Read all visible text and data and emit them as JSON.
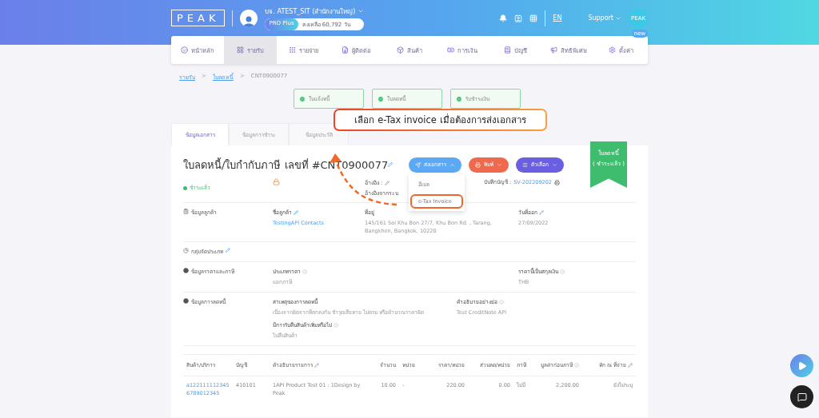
{
  "header": {
    "logo": "PEAK",
    "company": "บจ. ATEST_SIT (สำนักงานใหญ่)",
    "plan": "PRO Plus",
    "remaining": "คงเหลือ 60,792 วัน",
    "language": "EN",
    "support": "Support",
    "support_badge": "PEAK"
  },
  "nav": [
    {
      "label": "หน้าหลัก",
      "selected": false
    },
    {
      "label": "รายรับ",
      "selected": true
    },
    {
      "label": "รายจ่าย",
      "selected": false
    },
    {
      "label": "ผู้ติดต่อ",
      "selected": false
    },
    {
      "label": "สินค้า",
      "selected": false
    },
    {
      "label": "การเงิน",
      "selected": false
    },
    {
      "label": "บัญชี",
      "selected": false
    },
    {
      "label": "สิทธิพิเศษ",
      "selected": false
    },
    {
      "label": "ตั้งค่า",
      "selected": false,
      "badge": "new"
    }
  ],
  "breadcrumb": {
    "separator": ">",
    "items": [
      {
        "label": "รายรับ",
        "link": true
      },
      {
        "label": "ใบลดหนี้",
        "link": true
      },
      {
        "label": "CNT0900077",
        "link": false
      }
    ]
  },
  "steps": [
    {
      "label": "ใบแจ้งหนี้",
      "done": true
    },
    {
      "label": "ใบลดหนี้",
      "done": true
    },
    {
      "label": "รับชำระเงิน",
      "done": true
    }
  ],
  "callout": "เลือก e-Tax invoice เมื่อต้องการส่งเอกสาร",
  "tabs": [
    {
      "label": "ข้อมูลเอกสาร",
      "selected": true
    },
    {
      "label": "ข้อมูลการชำระ",
      "selected": false
    },
    {
      "label": "ข้อมูลประวัติ",
      "selected": false
    }
  ],
  "document": {
    "title": "ใบลดหนี้/ใบกำกับภาษี เลขที่ #CNT0900077",
    "actions": [
      {
        "label": "ส่งเอกสาร",
        "kind": "send",
        "expanded": true
      },
      {
        "label": "พิมพ์",
        "kind": "print",
        "expanded": false
      },
      {
        "label": "ตัวเลือก",
        "kind": "options",
        "expanded": false
      }
    ],
    "menu": [
      {
        "label": "อีเมล",
        "selected": false
      },
      {
        "label": "e-Tax Invoice",
        "selected": true
      }
    ],
    "ribbon": [
      "ใบลดหนี้",
      "( ชำระแล้ว )"
    ],
    "status": "ชำระแล้ว",
    "reference_label": "อ้างอิง :",
    "system_reference_label": "อ้างอิงจากระบ",
    "journal_label": "บันทึกบัญชี :",
    "journal": "SV-202209202"
  },
  "sections": [
    {
      "title": "ข้อมูลลูกค้า",
      "editable": false,
      "fields": [
        {
          "label": "ชื่อลูกค้า",
          "value": "TestingAPI Contacts",
          "link": true,
          "editable": true,
          "info": false
        },
        {
          "label": "ที่อยู่",
          "value": "145/161 Soi Khu Bon 27/7, Khu Bon Rd. , Tarang, Bangkhen, Bangkok, 10220",
          "link": false,
          "editable": false,
          "info": false
        },
        {
          "label": "วันที่ออก",
          "value": "27/09/2022",
          "link": false,
          "editable": true,
          "info": false
        }
      ]
    },
    {
      "title": "กลุ่มจัดประเภท",
      "editable": true
    },
    {
      "title": "ข้อมูลราคาและภาษี",
      "editable": false,
      "fields": [
        {
          "label": "ประเภทราคา",
          "value": "แยกภาษี",
          "link": false,
          "editable": false,
          "info": true
        },
        {
          "label": "ราคานี้เป็นสกุลเงิน",
          "value": "THB",
          "link": false,
          "editable": false,
          "info": true
        }
      ]
    },
    {
      "title": "ข้อมูลการลดหนี้",
      "editable": false,
      "fields": [
        {
          "label": "สาเหตุของการลดหนี้",
          "value": "เนื่องจากผิดจากที่ตกลงกัน ชำรุดเสียหาย ไม่ครบ หรือคำนวณราคาผิด",
          "link": false,
          "editable": false,
          "info": false
        },
        {
          "label": "คำอธิบายอย่างย่อ",
          "value": "Test CreditNote API",
          "link": false,
          "editable": false,
          "info": true
        },
        {
          "label": "มีการรับคืนสินค้าเพิ่มหรือไม่",
          "value": "ไม่คืนสินค้า",
          "link": false,
          "editable": false,
          "info": true
        }
      ]
    }
  ],
  "table": {
    "columns": [
      {
        "label": "สินค้า/บริการ",
        "editable": false,
        "info": false
      },
      {
        "label": "บัญชี",
        "editable": false,
        "info": false
      },
      {
        "label": "คำอธิบายรายการ",
        "editable": true,
        "info": false
      },
      {
        "label": "จำนวน",
        "editable": false,
        "info": false
      },
      {
        "label": "หน่วย",
        "editable": false,
        "info": false
      },
      {
        "label": "ราคา/หน่วย",
        "editable": false,
        "info": false
      },
      {
        "label": "ส่วนลด/หน่วย",
        "editable": false,
        "info": false
      },
      {
        "label": "ภาษี",
        "editable": false,
        "info": false
      },
      {
        "label": "มูลค่าก่อนภาษี",
        "editable": false,
        "info": true
      },
      {
        "label": "หัก ณ ที่จ่าย",
        "editable": true,
        "info": false
      }
    ],
    "rows": [
      [
        "a1221111123456789012345",
        "410101",
        "1API Product Test 01 : 1Design by Peak",
        "10.00",
        "-",
        "220.00",
        "0.00",
        "ไม่มี",
        "2,200.00",
        "ยังไม่ระบุ"
      ]
    ]
  }
}
